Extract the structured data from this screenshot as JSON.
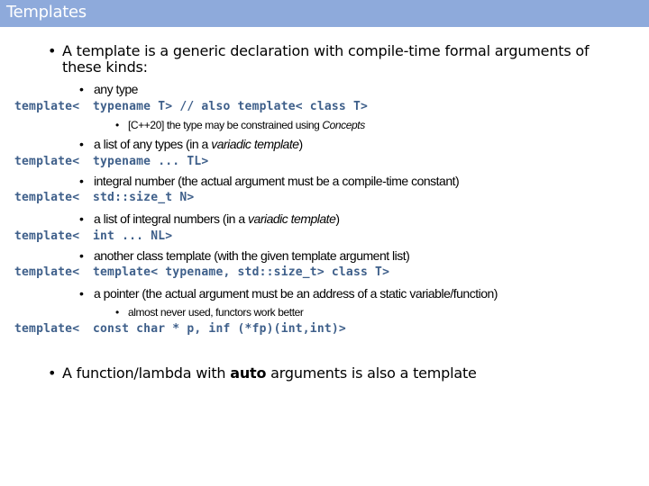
{
  "slide": {
    "title": "Templates",
    "intro": {
      "line1": "A template is a generic declaration with compile-time formal arguments of",
      "line2": "these kinds:"
    },
    "kinds": [
      {
        "label": "any type",
        "code_prefix": "template<",
        "code": "typename T>  // also template< class T>",
        "note_pre": "[C++20] the type may be constrained using ",
        "note_em": "Concepts"
      },
      {
        "label_pre": "a list of any types (in a ",
        "label_em": "variadic template",
        "label_post": ")",
        "code_prefix": "template<",
        "code": "typename ... TL>"
      },
      {
        "label": "integral number (the actual argument must be a compile-time constant)",
        "code_prefix": "template<",
        "code": "std::size_t N>"
      },
      {
        "label_pre": "a list of integral numbers (in a ",
        "label_em": "variadic template",
        "label_post": ")",
        "code_prefix": "template<",
        "code": "int ... NL>"
      },
      {
        "label": "another class template (with the given template argument list)",
        "code_prefix": "template<",
        "code": "template< typename, std::size_t> class T>"
      },
      {
        "label": "a pointer (the actual argument must be an address of a static variable/function)",
        "note": "almost never used, functors work better",
        "code_prefix": "template<",
        "code": "const char * p, inf (*fp)(int,int)>"
      }
    ],
    "final": {
      "pre": "A function/lambda with ",
      "bold": "auto",
      "post": " arguments is also a template"
    },
    "bullet": "•",
    "colors": {
      "header_bg": "#8eaadb",
      "code_text": "#3e5f8a"
    }
  }
}
